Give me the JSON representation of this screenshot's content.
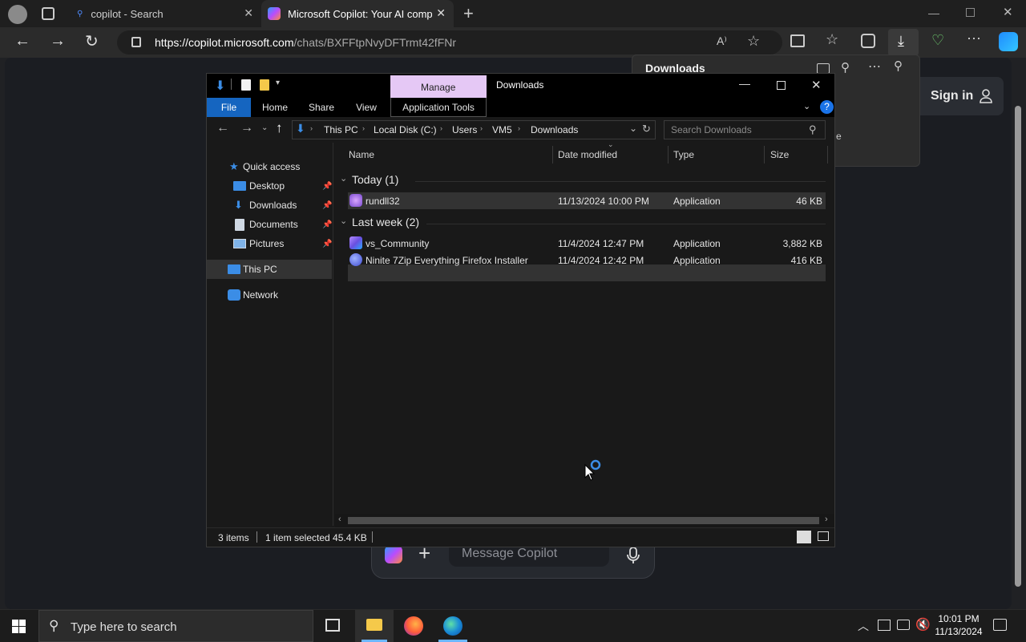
{
  "browser": {
    "tabs": [
      {
        "title": "copilot - Search"
      },
      {
        "title": "Microsoft Copilot: Your AI compa"
      }
    ],
    "url": {
      "host": "https://copilot.microsoft.com",
      "path": "/chats/BXFFtpNvyDFTrmt42fFNr"
    }
  },
  "downloads_panel": {
    "title": "Downloads",
    "partial_text": "e"
  },
  "copilot": {
    "sign_in": "Sign in",
    "message_placeholder": "Message Copilot"
  },
  "explorer": {
    "window_title": "Downloads",
    "context_tab": "Manage",
    "ribbon_tabs": [
      "File",
      "Home",
      "Share",
      "View",
      "Application Tools"
    ],
    "breadcrumb": [
      "This PC",
      "Local Disk (C:)",
      "Users",
      "VM5",
      "Downloads"
    ],
    "search_placeholder": "Search Downloads",
    "nav": {
      "quick_access": "Quick access",
      "pinned": [
        "Desktop",
        "Downloads",
        "Documents",
        "Pictures"
      ],
      "this_pc": "This PC",
      "network": "Network"
    },
    "columns": [
      "Name",
      "Date modified",
      "Type",
      "Size"
    ],
    "groups": [
      {
        "label": "Today (1)",
        "files": [
          {
            "name": "rundll32",
            "date": "11/13/2024 10:00 PM",
            "type": "Application",
            "size": "46 KB",
            "selected": true
          }
        ]
      },
      {
        "label": "Last week (2)",
        "files": [
          {
            "name": "vs_Community",
            "date": "11/4/2024 12:47 PM",
            "type": "Application",
            "size": "3,882 KB"
          },
          {
            "name": "Ninite 7Zip Everything Firefox Installer",
            "date": "11/4/2024 12:42 PM",
            "type": "Application",
            "size": "416 KB"
          }
        ]
      }
    ],
    "status": {
      "items": "3 items",
      "selected": "1 item selected  45.4 KB"
    }
  },
  "taskbar": {
    "search_placeholder": "Type here to search",
    "time": "10:01 PM",
    "date": "11/13/2024"
  },
  "colors": {
    "accent": "#0078d4",
    "manage_tab": "#e5c8f5",
    "file_tab": "#1565c0"
  }
}
